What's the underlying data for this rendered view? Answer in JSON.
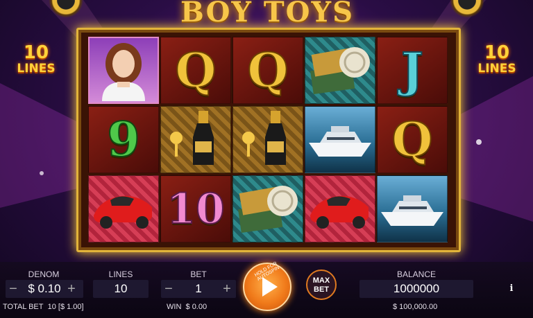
{
  "game": {
    "title": "BOY TOYS",
    "lines_badge_number": "10",
    "lines_badge_text": "LINES"
  },
  "reels": [
    [
      {
        "symbol": "girl-icon"
      },
      {
        "symbol": "9"
      },
      {
        "symbol": "sports-car-icon"
      }
    ],
    [
      {
        "symbol": "Q"
      },
      {
        "symbol": "champagne-icon"
      },
      {
        "symbol": "10"
      }
    ],
    [
      {
        "symbol": "Q"
      },
      {
        "symbol": "champagne-icon"
      },
      {
        "symbol": "cash-stack-icon"
      }
    ],
    [
      {
        "symbol": "cash-stack-icon"
      },
      {
        "symbol": "yacht-icon"
      },
      {
        "symbol": "sports-car-icon"
      }
    ],
    [
      {
        "symbol": "J"
      },
      {
        "symbol": "Q"
      },
      {
        "symbol": "yacht-icon"
      }
    ]
  ],
  "controls": {
    "denom_label": "DENOM",
    "denom_value": "$ 0.10",
    "lines_label": "LINES",
    "lines_value": "10",
    "bet_label": "BET",
    "bet_value": "1",
    "spin_hint": "HOLD FOR AUTOSPIN",
    "maxbet_label_1": "MAX",
    "maxbet_label_2": "BET",
    "balance_label": "BALANCE",
    "balance_value": "1000000",
    "minus": "−",
    "plus": "+",
    "info": "i"
  },
  "footer": {
    "total_bet_label": "TOTAL BET",
    "total_bet_value": "10 [$ 1.00]",
    "win_label": "WIN",
    "win_value": "$ 0.00",
    "balance_money": "$ 100,000.00"
  },
  "colors": {
    "accent_gold": "#e2b43a",
    "spin_orange": "#f07a1a",
    "background": "#2a0d45"
  }
}
